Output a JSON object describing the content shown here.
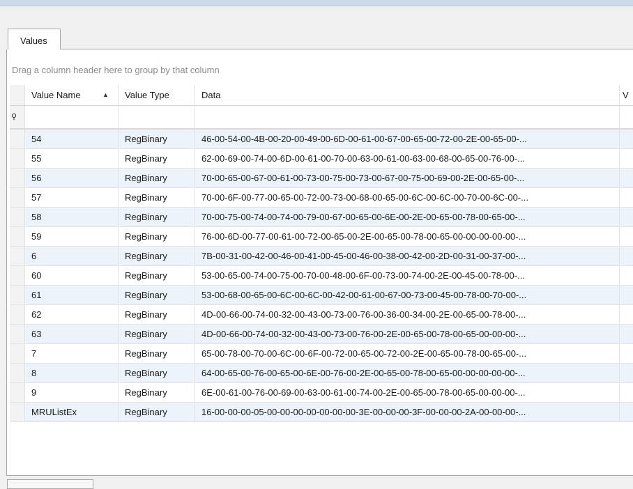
{
  "tab": {
    "label": "Values"
  },
  "group_hint": "Drag a column header here to group by that column",
  "columns": {
    "name": "Value Name",
    "type": "Value Type",
    "data": "Data",
    "extra": "V"
  },
  "rows": [
    {
      "name": "54",
      "type": "RegBinary",
      "data": "46-00-54-00-4B-00-20-00-49-00-6D-00-61-00-67-00-65-00-72-00-2E-00-65-00-..."
    },
    {
      "name": "55",
      "type": "RegBinary",
      "data": "62-00-69-00-74-00-6D-00-61-00-70-00-63-00-61-00-63-00-68-00-65-00-76-00-..."
    },
    {
      "name": "56",
      "type": "RegBinary",
      "data": "70-00-65-00-67-00-61-00-73-00-75-00-73-00-67-00-75-00-69-00-2E-00-65-00-..."
    },
    {
      "name": "57",
      "type": "RegBinary",
      "data": "70-00-6F-00-77-00-65-00-72-00-73-00-68-00-65-00-6C-00-6C-00-70-00-6C-00-..."
    },
    {
      "name": "58",
      "type": "RegBinary",
      "data": "70-00-75-00-74-00-74-00-79-00-67-00-65-00-6E-00-2E-00-65-00-78-00-65-00-..."
    },
    {
      "name": "59",
      "type": "RegBinary",
      "data": "76-00-6D-00-77-00-61-00-72-00-65-00-2E-00-65-00-78-00-65-00-00-00-00-00-..."
    },
    {
      "name": "6",
      "type": "RegBinary",
      "data": "7B-00-31-00-42-00-46-00-41-00-45-00-46-00-38-00-42-00-2D-00-31-00-37-00-..."
    },
    {
      "name": "60",
      "type": "RegBinary",
      "data": "53-00-65-00-74-00-75-00-70-00-48-00-6F-00-73-00-74-00-2E-00-45-00-78-00-..."
    },
    {
      "name": "61",
      "type": "RegBinary",
      "data": "53-00-68-00-65-00-6C-00-6C-00-42-00-61-00-67-00-73-00-45-00-78-00-70-00-..."
    },
    {
      "name": "62",
      "type": "RegBinary",
      "data": "4D-00-66-00-74-00-32-00-43-00-73-00-76-00-36-00-34-00-2E-00-65-00-78-00-..."
    },
    {
      "name": "63",
      "type": "RegBinary",
      "data": "4D-00-66-00-74-00-32-00-43-00-73-00-76-00-2E-00-65-00-78-00-65-00-00-00-..."
    },
    {
      "name": "7",
      "type": "RegBinary",
      "data": "65-00-78-00-70-00-6C-00-6F-00-72-00-65-00-72-00-2E-00-65-00-78-00-65-00-..."
    },
    {
      "name": "8",
      "type": "RegBinary",
      "data": "64-00-65-00-76-00-65-00-6E-00-76-00-2E-00-65-00-78-00-65-00-00-00-00-00-..."
    },
    {
      "name": "9",
      "type": "RegBinary",
      "data": "6E-00-61-00-76-00-69-00-63-00-61-00-74-00-2E-00-65-00-78-00-65-00-00-00-..."
    },
    {
      "name": "MRUListEx",
      "type": "RegBinary",
      "data": "16-00-00-00-05-00-00-00-00-00-00-00-3E-00-00-00-3F-00-00-00-2A-00-00-00-..."
    }
  ],
  "colors": {
    "alt_row": "#edf3fb",
    "grid_line": "#e3e3e3",
    "tab_border": "#a8a8a8"
  }
}
